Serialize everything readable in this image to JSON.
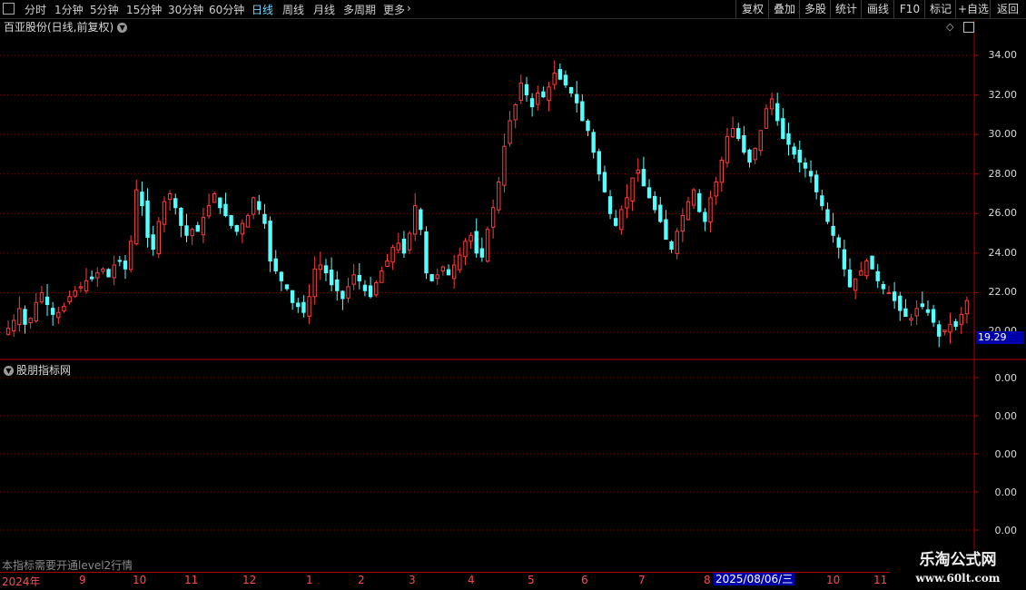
{
  "toolbar": {
    "left_items": [
      "分时",
      "1分钟",
      "5分钟",
      "15分钟",
      "30分钟",
      "60分钟",
      "日线",
      "周线",
      "月线",
      "多周期",
      "更多"
    ],
    "active_item": "日线",
    "right_buttons": [
      "复权",
      "叠加",
      "多股",
      "统计",
      "画线",
      "F10",
      "标记",
      "+自选",
      "返回"
    ]
  },
  "main_panel": {
    "title": "百亚股份(日线,前复权)",
    "price_axis": [
      "34.00",
      "32.00",
      "30.00",
      "28.00",
      "26.00",
      "24.00",
      "22.00",
      "20.00"
    ],
    "last_price": "19.29"
  },
  "sub_panel": {
    "title": "股朋指标网",
    "axis": [
      "0.00",
      "0.00",
      "0.00",
      "0.00",
      "0.00"
    ],
    "notice": "本指标需要开通level2行情"
  },
  "date_axis": [
    "2024年",
    "9",
    "10",
    "11",
    "12",
    "1",
    "2",
    "3",
    "4",
    "5",
    "6",
    "7",
    "8",
    "10",
    "11"
  ],
  "cursor_date": "2025/08/06/三",
  "watermark": {
    "name": "乐淘公式网",
    "url": "www.60lt.com"
  },
  "colors": {
    "up": "#ff3c3c",
    "down": "#54ffff",
    "grid": "#7a0000",
    "axis_line": "#aa0000",
    "active": "#6fd8ff",
    "badge": "#0000aa"
  },
  "chart_data": {
    "type": "candlestick",
    "ylim": [
      19.3,
      35.0
    ],
    "closes": [
      20.2,
      20.6,
      21.2,
      20.4,
      20.7,
      21.5,
      22.0,
      21.4,
      20.9,
      21.0,
      21.3,
      21.8,
      22.1,
      22.3,
      22.6,
      22.7,
      23.0,
      23.2,
      22.8,
      23.4,
      23.6,
      23.2,
      24.6,
      27.2,
      26.4,
      24.8,
      24.2,
      25.6,
      26.6,
      27.0,
      26.3,
      25.4,
      24.9,
      25.2,
      25.1,
      25.8,
      26.4,
      27.0,
      26.3,
      25.9,
      25.4,
      25.1,
      25.5,
      25.9,
      26.8,
      26.2,
      25.5,
      23.6,
      23.1,
      22.6,
      22.2,
      21.5,
      21.3,
      21.0,
      21.8,
      23.2,
      23.4,
      23.0,
      22.4,
      22.1,
      21.7,
      22.3,
      22.9,
      22.6,
      22.1,
      21.8,
      22.5,
      23.1,
      23.6,
      24.3,
      24.5,
      24.0,
      25.0,
      26.4,
      25.2,
      23.0,
      22.6,
      22.9,
      23.3,
      22.9,
      23.4,
      23.9,
      24.6,
      24.9,
      24.0,
      23.8,
      25.2,
      26.3,
      27.6,
      29.4,
      30.7,
      31.5,
      32.6,
      32.0,
      31.4,
      32.1,
      31.9,
      32.4,
      33.1,
      32.8,
      32.5,
      32.1,
      31.6,
      30.7,
      30.2,
      29.1,
      28.0,
      27.1,
      26.0,
      25.4,
      26.2,
      26.8,
      27.8,
      28.2,
      27.4,
      26.8,
      26.2,
      25.6,
      24.7,
      24.2,
      25.1,
      25.9,
      26.6,
      27.2,
      26.1,
      25.6,
      26.8,
      27.6,
      28.7,
      29.9,
      30.3,
      29.8,
      29.1,
      28.6,
      29.3,
      30.2,
      31.3,
      31.8,
      30.7,
      29.8,
      29.5,
      29.0,
      28.6,
      28.3,
      27.9,
      27.1,
      26.4,
      25.6,
      24.9,
      24.3,
      23.2,
      22.3,
      22.7,
      23.1,
      23.6,
      23.2,
      22.6,
      22.2,
      22.0,
      21.6,
      21.1,
      20.8,
      20.7,
      21.2,
      21.3,
      21.0,
      20.5,
      19.8,
      20.1,
      20.4,
      20.3,
      20.9,
      21.6
    ]
  }
}
